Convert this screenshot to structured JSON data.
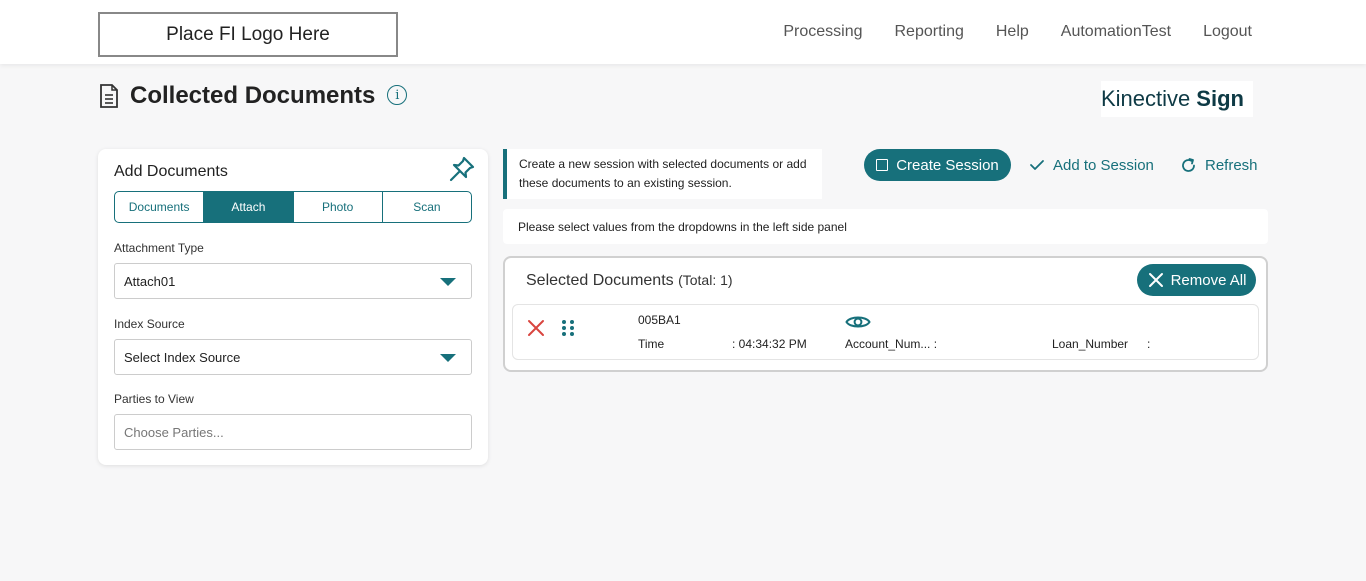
{
  "header": {
    "logo_text": "Place FI Logo Here",
    "nav": [
      "Processing",
      "Reporting",
      "Help",
      "AutomationTest",
      "Logout"
    ]
  },
  "page": {
    "title": "Collected Documents",
    "info_icon": "i",
    "brand_light": "Kinective",
    "brand_bold": "Sign"
  },
  "add_documents": {
    "title": "Add Documents",
    "tabs": [
      "Documents",
      "Attach",
      "Photo",
      "Scan"
    ],
    "active_tab": "Attach",
    "attachment_type_label": "Attachment Type",
    "attachment_type_value": "Attach01",
    "index_source_label": "Index Source",
    "index_source_value": "Select Index Source",
    "parties_label": "Parties to View",
    "parties_placeholder": "Choose Parties..."
  },
  "session": {
    "note": "Create a new session with selected documents or add these documents to an existing session.",
    "create_label": "Create Session",
    "add_label": "Add to Session",
    "refresh_label": "Refresh",
    "message": "Please select values from the dropdowns in the left side panel"
  },
  "selected": {
    "title": "Selected Documents",
    "total": "(Total: 1)",
    "remove_all_label": "Remove All",
    "documents": [
      {
        "name": "005BA1",
        "time_label": "Time",
        "time_value": ": 04:34:32 PM",
        "account_label": "Account_Num... :",
        "loan_label": "Loan_Number",
        "loan_value": ":"
      }
    ]
  },
  "colors": {
    "accent": "#17707b",
    "danger": "#d9453f"
  }
}
